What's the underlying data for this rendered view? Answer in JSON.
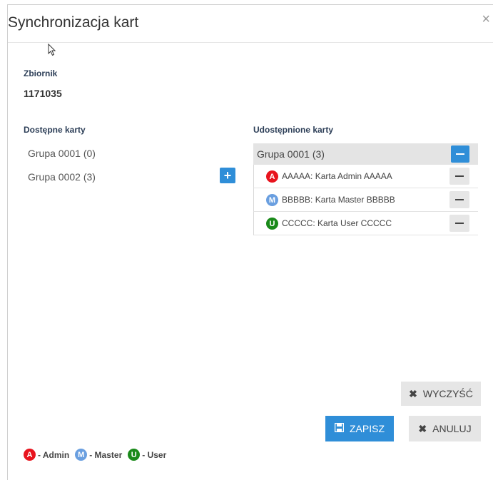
{
  "dialog": {
    "title": "Synchronizacja kart",
    "close_icon": "×"
  },
  "zbiornik": {
    "label": "Zbiornik",
    "value": "1171035"
  },
  "available": {
    "label": "Dostępne karty",
    "items": [
      "Grupa 0001 (0)",
      "Grupa 0002 (3)"
    ]
  },
  "shared": {
    "label": "Udostępnione karty",
    "group": "Grupa 0001 (3)",
    "cards": [
      {
        "letter": "A",
        "text": "AAAAA: Karta Admin AAAAA",
        "color": "#e8141e"
      },
      {
        "letter": "M",
        "text": "BBBBB: Karta Master BBBBB",
        "color": "#6a9fe0"
      },
      {
        "letter": "U",
        "text": "CCCCC: Karta User CCCCC",
        "color": "#1a8a1a"
      }
    ]
  },
  "buttons": {
    "clear": "WYCZYŚĆ",
    "save": "ZAPISZ",
    "cancel": "ANULUJ"
  },
  "legend": [
    {
      "letter": "A",
      "text": "- Admin",
      "color": "#e8141e"
    },
    {
      "letter": "M",
      "text": "- Master",
      "color": "#6a9fe0"
    },
    {
      "letter": "U",
      "text": "- User",
      "color": "#1a8a1a"
    }
  ]
}
